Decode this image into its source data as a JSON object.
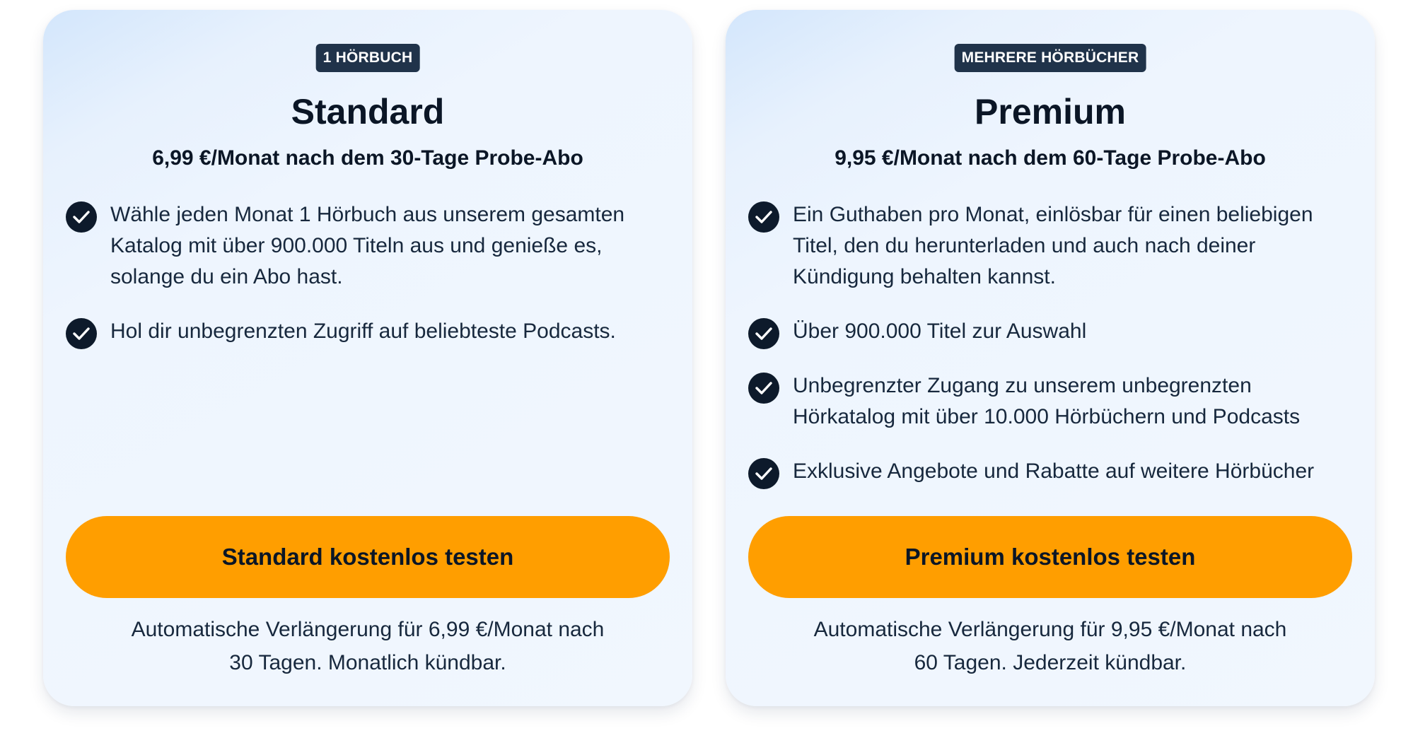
{
  "colors": {
    "card_background": "#eef5fe",
    "badge_background": "#20334a",
    "cta_background": "#ff9e00",
    "check_background": "#0d1a2b",
    "text": "#0f1c2e"
  },
  "plans": [
    {
      "badge": "1 HÖRBUCH",
      "title": "Standard",
      "price": "6,99 €/Monat nach dem 30-Tage Probe-Abo",
      "features": [
        "Wähle jeden Monat 1 Hörbuch aus unserem gesamten Katalog mit über 900.000 Titeln aus und genieße es, solange du ein Abo hast.",
        "Hol dir unbegrenzten Zugriff auf beliebteste Podcasts."
      ],
      "cta_label": "Standard kostenlos testen",
      "renewal_line1": "Automatische Verlängerung für 6,99 €/Monat nach",
      "renewal_line2": "30 Tagen. Monatlich kündbar."
    },
    {
      "badge": "MEHRERE HÖRBÜCHER",
      "title": "Premium",
      "price": "9,95 €/Monat nach dem 60-Tage Probe-Abo",
      "features": [
        "Ein Guthaben pro Monat, einlösbar für einen beliebigen Titel, den du herunterladen und auch nach deiner Kündigung behalten kannst.",
        "Über 900.000 Titel zur Auswahl",
        "Unbegrenzter Zugang zu unserem unbegrenzten Hörkatalog mit über 10.000 Hörbüchern und Podcasts",
        "Exklusive Angebote und Rabatte auf weitere Hörbücher"
      ],
      "cta_label": "Premium kostenlos testen",
      "renewal_line1": "Automatische Verlängerung für 9,95 €/Monat nach",
      "renewal_line2": "60 Tagen. Jederzeit kündbar."
    }
  ],
  "icons": {
    "feature_bullet": "check-circle-icon"
  }
}
